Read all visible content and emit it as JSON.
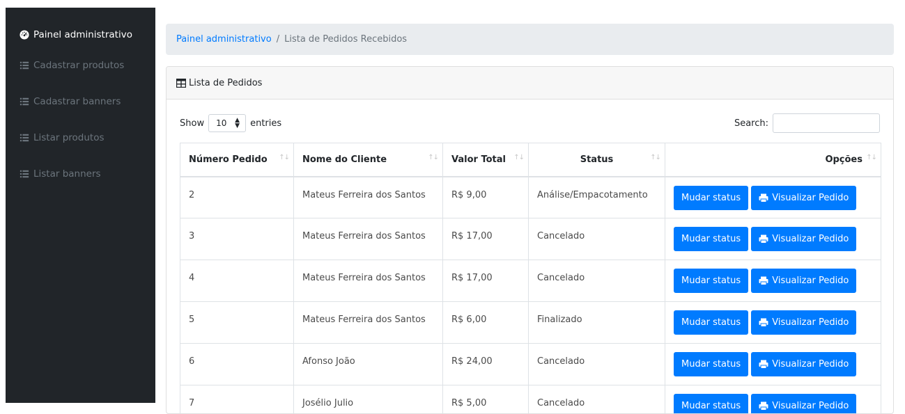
{
  "sidebar": {
    "items": [
      {
        "label": "Painel administrativo",
        "icon": "tachometer-icon",
        "active": true
      },
      {
        "label": "Cadastrar produtos",
        "icon": "list-icon",
        "active": false
      },
      {
        "label": "Cadastrar banners",
        "icon": "list-icon",
        "active": false
      },
      {
        "label": "Listar produtos",
        "icon": "list-icon",
        "active": false
      },
      {
        "label": "Listar banners",
        "icon": "list-icon",
        "active": false
      }
    ]
  },
  "breadcrumb": {
    "home": "Painel administrativo",
    "separator": "/",
    "current": "Lista de Pedidos Recebidos"
  },
  "card": {
    "title": "Lista de Pedidos",
    "icon": "table-icon"
  },
  "datatable": {
    "show_label": "Show",
    "entries_value": "10",
    "entries_label": "entries",
    "search_label": "Search:",
    "search_value": ""
  },
  "table": {
    "columns": [
      "Número Pedido",
      "Nome do Cliente",
      "Valor Total",
      "Status",
      "Opções"
    ],
    "sort_glyph": "↑↓",
    "rows": [
      {
        "numero": "2",
        "cliente": "Mateus Ferreira dos Santos",
        "valor": "R$ 9,00",
        "status": "Análise/Empacotamento"
      },
      {
        "numero": "3",
        "cliente": "Mateus Ferreira dos Santos",
        "valor": "R$ 17,00",
        "status": "Cancelado"
      },
      {
        "numero": "4",
        "cliente": "Mateus Ferreira dos Santos",
        "valor": "R$ 17,00",
        "status": "Cancelado"
      },
      {
        "numero": "5",
        "cliente": "Mateus Ferreira dos Santos",
        "valor": "R$ 6,00",
        "status": "Finalizado"
      },
      {
        "numero": "6",
        "cliente": "Afonso João",
        "valor": "R$ 24,00",
        "status": "Cancelado"
      },
      {
        "numero": "7",
        "cliente": "Josélio Julio",
        "valor": "R$ 5,00",
        "status": "Cancelado"
      }
    ],
    "button_status": "Mudar status",
    "button_view": "Visualizar Pedido"
  },
  "colors": {
    "sidebar_bg": "#212529",
    "primary": "#007bff",
    "breadcrumb_bg": "#e9ecef"
  }
}
